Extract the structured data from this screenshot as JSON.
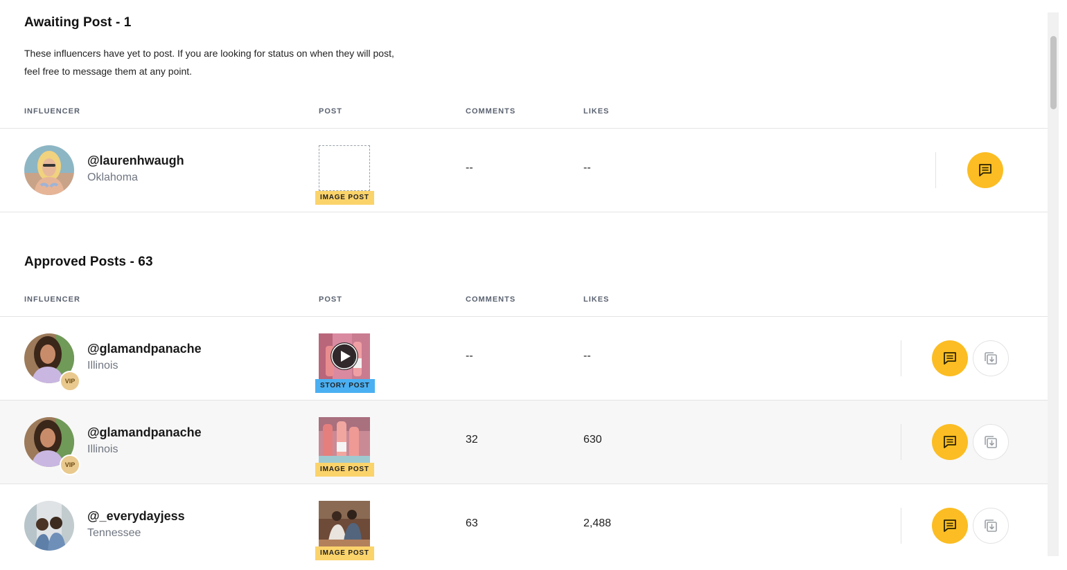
{
  "awaiting": {
    "title": "Awaiting Post - 1",
    "description": "These influencers have yet to post. If you are looking for status on when they will post, feel free to message them at any point.",
    "columns": {
      "influencer": "INFLUENCER",
      "post": "POST",
      "comments": "COMMENTS",
      "likes": "LIKES"
    },
    "rows": [
      {
        "handle": "@laurenhwaugh",
        "location": "Oklahoma",
        "post_type": "IMAGE POST",
        "comments": "--",
        "likes": "--"
      }
    ]
  },
  "approved": {
    "title": "Approved Posts - 63",
    "columns": {
      "influencer": "INFLUENCER",
      "post": "POST",
      "comments": "COMMENTS",
      "likes": "LIKES"
    },
    "vip_label": "VIP",
    "rows": [
      {
        "handle": "@glamandpanache",
        "location": "Illinois",
        "vip": true,
        "post_type": "STORY POST",
        "comments": "--",
        "likes": "--"
      },
      {
        "handle": "@glamandpanache",
        "location": "Illinois",
        "vip": true,
        "post_type": "IMAGE POST",
        "comments": "32",
        "likes": "630"
      },
      {
        "handle": "@_everydayjess",
        "location": "Tennessee",
        "vip": false,
        "post_type": "IMAGE POST",
        "comments": "63",
        "likes": "2,488"
      }
    ]
  },
  "icons": {
    "message": "message-icon",
    "download": "download-icon",
    "play": "play-icon"
  },
  "colors": {
    "accent": "#fbbd23",
    "image_tag": "#fbd36b",
    "story_tag": "#4ab0f2",
    "muted_text": "#6f7580"
  }
}
